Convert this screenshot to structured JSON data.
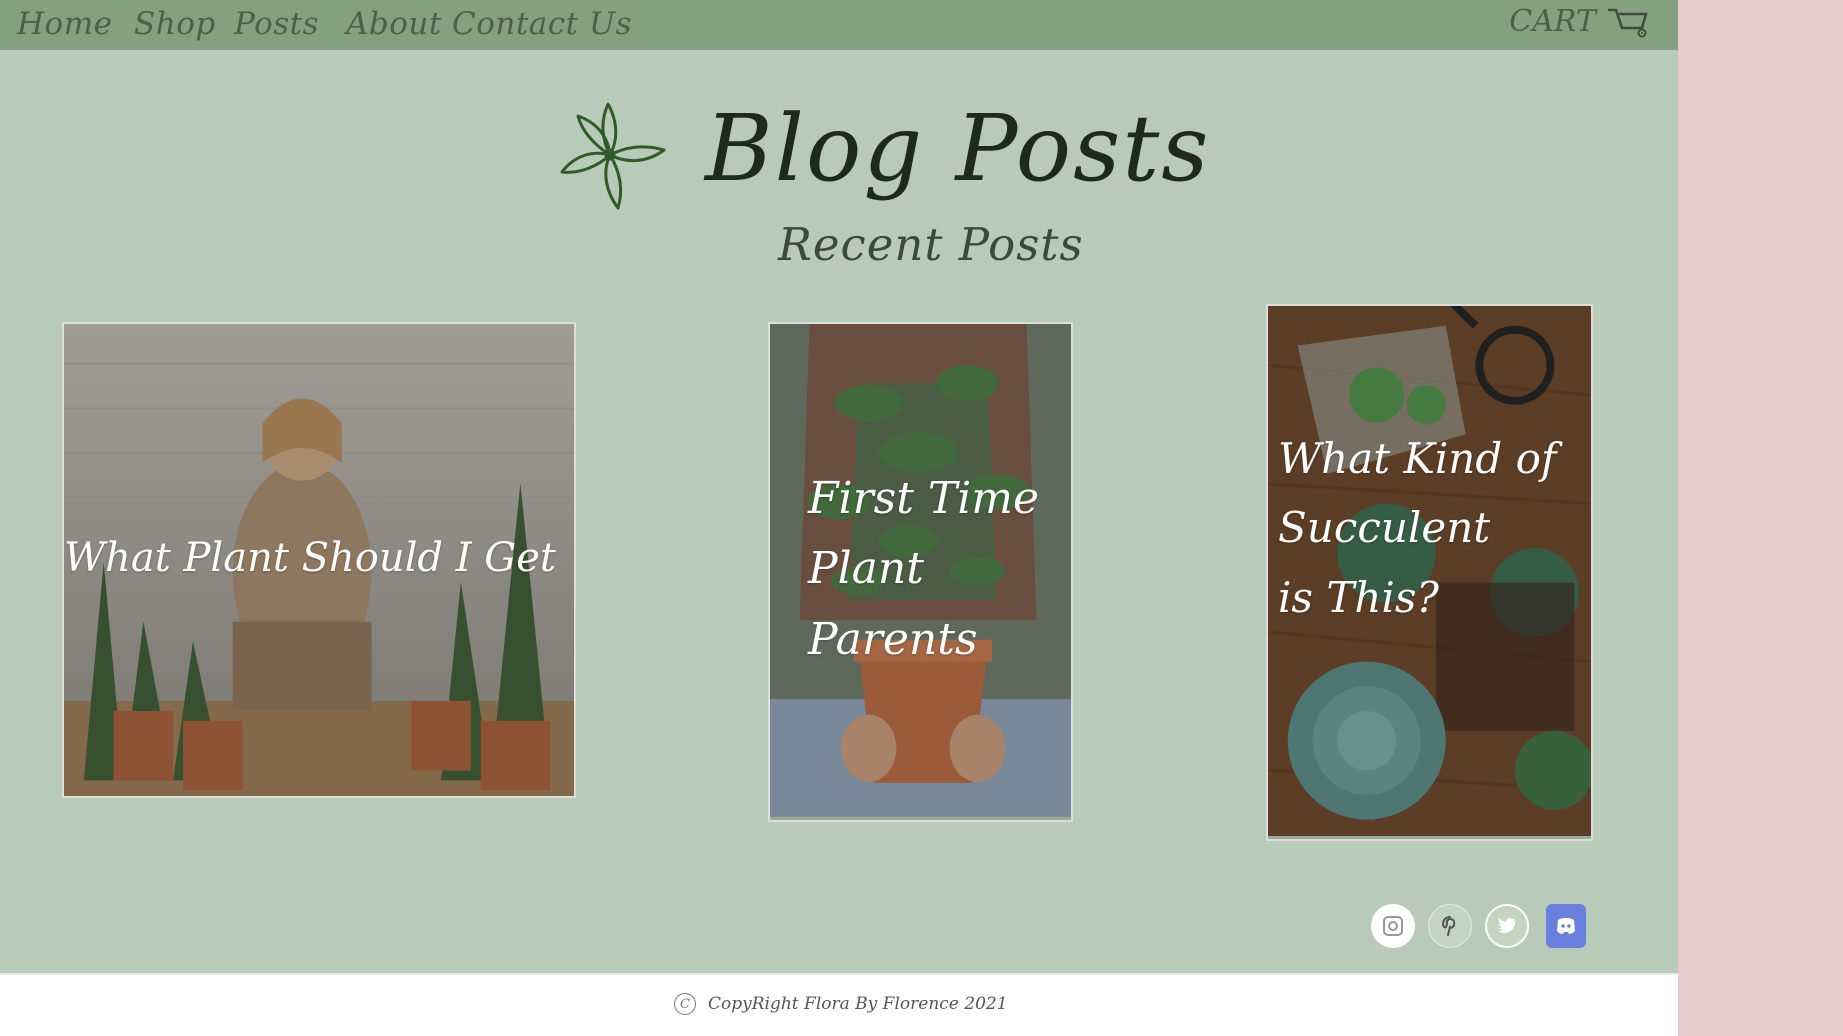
{
  "nav": {
    "home": "Home",
    "shop": "Shop",
    "posts": "Posts",
    "about": "About",
    "contact": "Contact Us",
    "cart": "CART"
  },
  "header": {
    "title": "Blog Posts",
    "subtitle": "Recent Posts"
  },
  "posts": [
    {
      "title": "What Plant Should I Get",
      "image": "woman-reading-among-potted-plants"
    },
    {
      "title_lines": [
        "First Time",
        "Plant",
        "Parents"
      ],
      "image": "person-holding-potted-plant"
    },
    {
      "title_lines": [
        "What Kind of",
        "Succulent",
        "is This?"
      ],
      "image": "succulents-on-wooden-table"
    }
  ],
  "social": [
    "instagram-icon",
    "pinterest-icon",
    "twitter-icon",
    "discord-icon"
  ],
  "footer": {
    "copyright": "CopyRight Flora By Florence 2021",
    "symbol": "C"
  },
  "colors": {
    "topbar": "#84a07f",
    "page": "#b8cbb8",
    "side": "#e8cbcf",
    "accent_green": "#2f5a2a",
    "discord": "#6b7fe0"
  }
}
